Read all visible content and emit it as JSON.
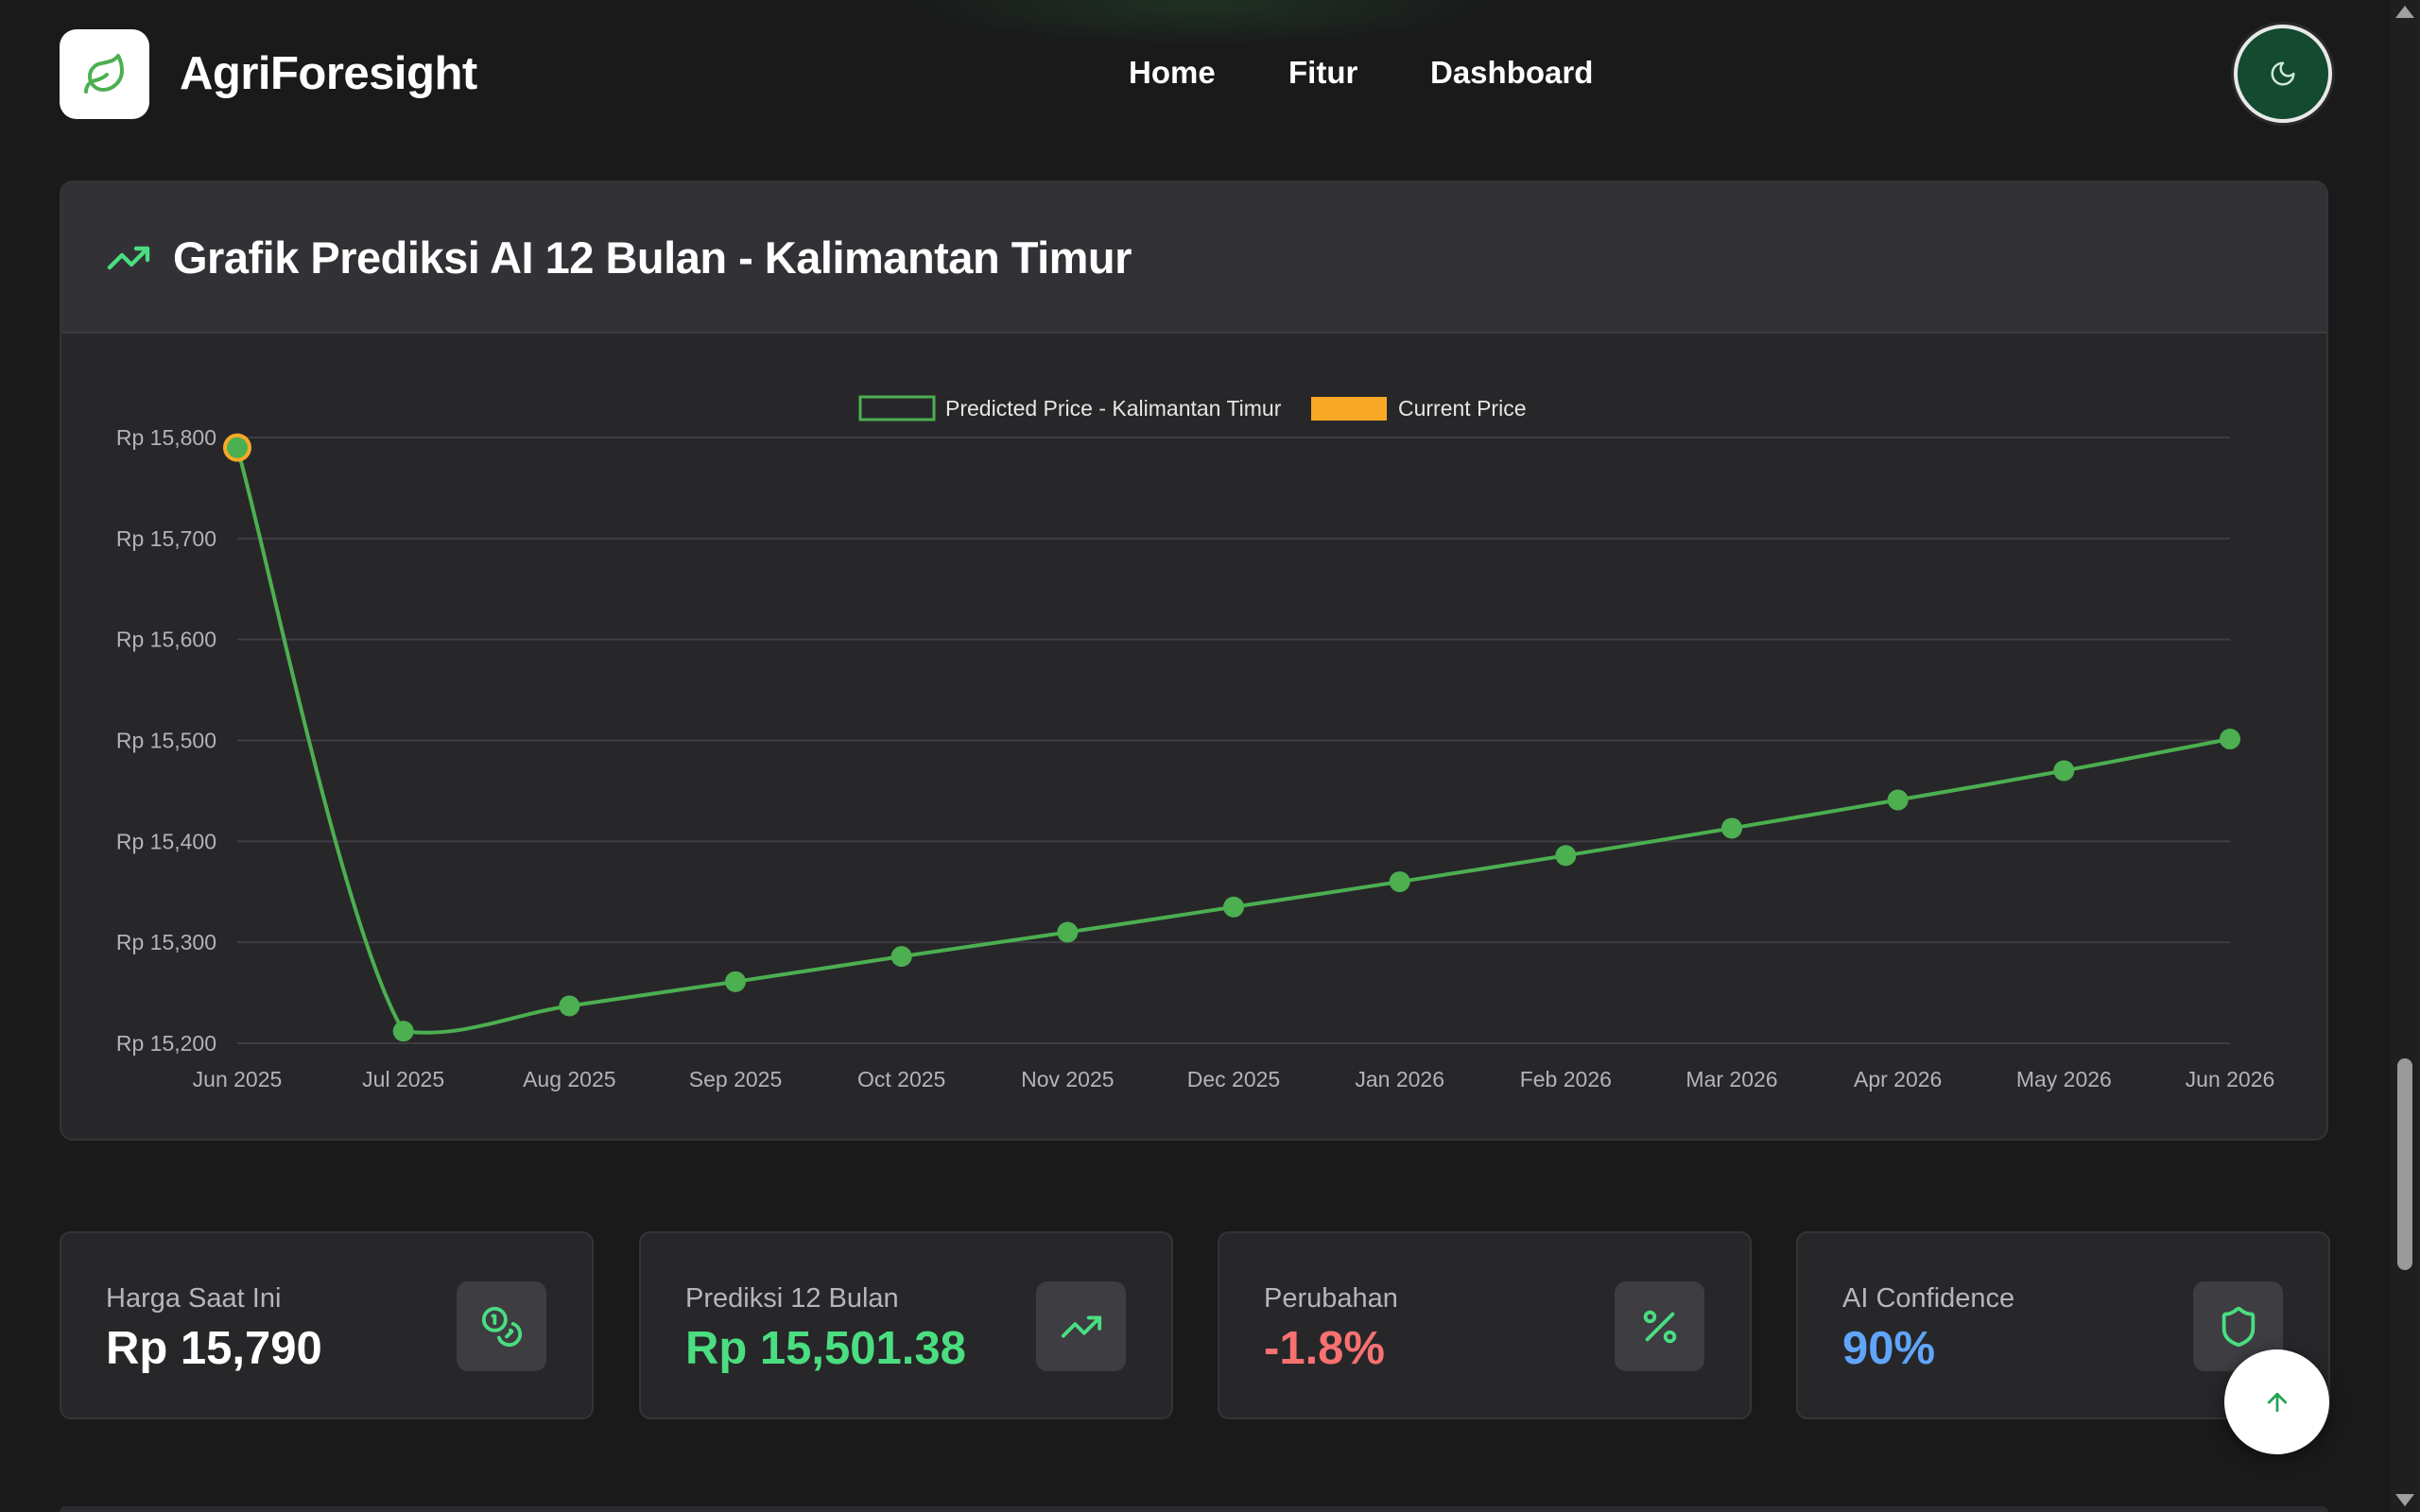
{
  "header": {
    "brand": "AgriForesight",
    "nav": [
      "Home",
      "Fitur",
      "Dashboard"
    ],
    "logo_icon": "leaf-icon",
    "theme_icon": "moon-icon"
  },
  "chart_card": {
    "title": "Grafik Prediksi AI 12 Bulan - Kalimantan Timur",
    "icon": "trending-up-icon"
  },
  "chart_data": {
    "type": "line",
    "x": [
      "Jun 2025",
      "Jul 2025",
      "Aug 2025",
      "Sep 2025",
      "Oct 2025",
      "Nov 2025",
      "Dec 2025",
      "Jan 2026",
      "Feb 2026",
      "Mar 2026",
      "Apr 2026",
      "May 2026",
      "Jun 2026"
    ],
    "series": [
      {
        "name": "Predicted Price - Kalimantan Timur",
        "color": "#4caf50",
        "values": [
          15790,
          15212,
          15237,
          15261,
          15286,
          15310,
          15335,
          15360,
          15386,
          15413,
          15441,
          15470,
          15501.38
        ]
      },
      {
        "name": "Current Price",
        "color": "#f9a825",
        "points": [
          {
            "x": "Jun 2025",
            "y": 15790
          }
        ]
      }
    ],
    "yticks": [
      "Rp 15,800",
      "Rp 15,700",
      "Rp 15,600",
      "Rp 15,500",
      "Rp 15,400",
      "Rp 15,300",
      "Rp 15,200"
    ],
    "ylim": [
      15200,
      15800
    ],
    "legend": "top-center",
    "grid": true
  },
  "stats": [
    {
      "label": "Harga Saat Ini",
      "value": "Rp 15,790",
      "icon": "coins-icon",
      "value_color": "#ffffff"
    },
    {
      "label": "Prediksi 12 Bulan",
      "value": "Rp 15,501.38",
      "icon": "trending-up-icon",
      "value_color": "#4ade80"
    },
    {
      "label": "Perubahan",
      "value": "-1.8%",
      "icon": "percent-icon",
      "value_color": "#f87171"
    },
    {
      "label": "AI Confidence",
      "value": "90%",
      "icon": "shield-icon",
      "value_color": "#60a5fa"
    }
  ],
  "fab_icon": "arrow-up-icon",
  "colors": {
    "accent": "#4caf50",
    "background": "#1a1a1b",
    "card": "#27272a"
  }
}
